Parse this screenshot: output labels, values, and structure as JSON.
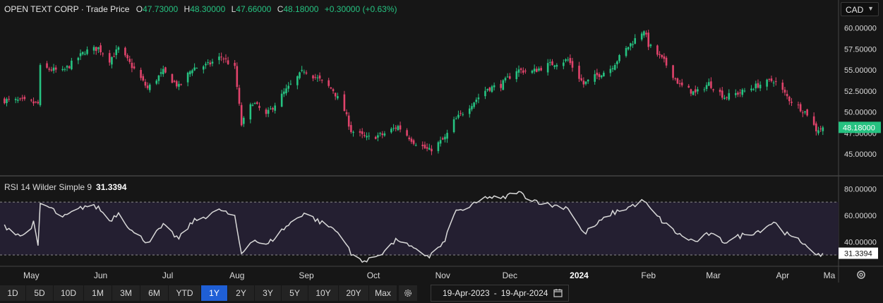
{
  "header": {
    "title": "OPEN TEXT CORP",
    "subtitle": "Trade Price",
    "ohlc": [
      {
        "label": "O",
        "value": "47.73000"
      },
      {
        "label": "H",
        "value": "48.30000"
      },
      {
        "label": "L",
        "value": "47.66000"
      },
      {
        "label": "C",
        "value": "48.18000"
      }
    ],
    "change": "+0.30000 (+0.63%)"
  },
  "currency": "CAD",
  "rsi_legend": {
    "label": "RSI 14 Wilder Simple 9",
    "value": "31.3394"
  },
  "toolbar": {
    "ranges": [
      "1D",
      "5D",
      "10D",
      "1M",
      "3M",
      "6M",
      "YTD",
      "1Y",
      "2Y",
      "3Y",
      "5Y",
      "10Y",
      "20Y",
      "Max"
    ],
    "active": "1Y",
    "date_from": "19-Apr-2023",
    "date_sep": "-",
    "date_to": "19-Apr-2024"
  },
  "colors": {
    "up": "#26c281",
    "down": "#e0436b",
    "rsi": "#d8d8d8",
    "band": "#241f31",
    "active_button": "#1f5fd6"
  },
  "chart_data": [
    {
      "type": "candlestick",
      "title": "OPEN TEXT CORP · Trade Price",
      "ylim": [
        42.5,
        60.8
      ],
      "yticks": [
        "60.00000",
        "57.50000",
        "55.00000",
        "52.50000",
        "50.00000",
        "47.50000",
        "45.00000"
      ],
      "last_price_label": "48.18000",
      "x_ticks": [
        "May",
        "Jun",
        "Jul",
        "Aug",
        "Sep",
        "Oct",
        "Nov",
        "Dec",
        "2024",
        "Feb",
        "Mar",
        "Apr",
        "Ma"
      ],
      "close_anchors": [
        [
          "2023-04-19",
          51.4
        ],
        [
          "2023-04-27",
          51.3
        ],
        [
          "2023-05-04",
          51.0
        ],
        [
          "2023-05-05",
          55.3
        ],
        [
          "2023-05-15",
          54.8
        ],
        [
          "2023-05-25",
          57.2
        ],
        [
          "2023-05-31",
          57.6
        ],
        [
          "2023-06-05",
          56.2
        ],
        [
          "2023-06-09",
          57.5
        ],
        [
          "2023-06-16",
          55.1
        ],
        [
          "2023-06-22",
          52.8
        ],
        [
          "2023-06-29",
          54.8
        ],
        [
          "2023-07-06",
          53.0
        ],
        [
          "2023-07-12",
          55.2
        ],
        [
          "2023-07-19",
          55.6
        ],
        [
          "2023-07-25",
          56.6
        ],
        [
          "2023-07-31",
          55.2
        ],
        [
          "2023-08-03",
          48.5
        ],
        [
          "2023-08-08",
          51.2
        ],
        [
          "2023-08-14",
          49.6
        ],
        [
          "2023-08-22",
          52.3
        ],
        [
          "2023-08-31",
          55.0
        ],
        [
          "2023-09-07",
          53.8
        ],
        [
          "2023-09-13",
          52.6
        ],
        [
          "2023-09-18",
          50.2
        ],
        [
          "2023-09-21",
          47.8
        ],
        [
          "2023-09-28",
          46.9
        ],
        [
          "2023-10-05",
          47.3
        ],
        [
          "2023-10-12",
          48.3
        ],
        [
          "2023-10-19",
          46.5
        ],
        [
          "2023-10-26",
          45.4
        ],
        [
          "2023-11-02",
          46.9
        ],
        [
          "2023-11-06",
          48.9
        ],
        [
          "2023-11-14",
          51.0
        ],
        [
          "2023-11-21",
          52.8
        ],
        [
          "2023-11-27",
          53.2
        ],
        [
          "2023-12-04",
          55.0
        ],
        [
          "2023-12-11",
          54.8
        ],
        [
          "2023-12-18",
          55.6
        ],
        [
          "2023-12-27",
          56.2
        ],
        [
          "2024-01-03",
          53.3
        ],
        [
          "2024-01-08",
          54.2
        ],
        [
          "2024-01-15",
          55.2
        ],
        [
          "2024-01-23",
          57.8
        ],
        [
          "2024-01-30",
          59.8
        ],
        [
          "2024-02-01",
          58.0
        ],
        [
          "2024-02-08",
          56.0
        ],
        [
          "2024-02-15",
          53.2
        ],
        [
          "2024-02-22",
          52.2
        ],
        [
          "2024-02-28",
          53.4
        ],
        [
          "2024-03-06",
          51.8
        ],
        [
          "2024-03-14",
          52.4
        ],
        [
          "2024-03-21",
          53.2
        ],
        [
          "2024-03-28",
          53.8
        ],
        [
          "2024-04-04",
          51.5
        ],
        [
          "2024-04-12",
          49.8
        ],
        [
          "2024-04-16",
          47.9
        ],
        [
          "2024-04-19",
          48.18
        ]
      ]
    },
    {
      "type": "line",
      "title": "RSI 14 Wilder Simple 9",
      "ylim": [
        22,
        85
      ],
      "yticks": [
        "80.00000",
        "60.00000",
        "40.00000"
      ],
      "bands": [
        30,
        70
      ],
      "last_value_label": "31.3394",
      "anchors": [
        [
          "2023-04-19",
          52
        ],
        [
          "2023-04-27",
          44
        ],
        [
          "2023-05-02",
          54
        ],
        [
          "2023-05-04",
          36
        ],
        [
          "2023-05-05",
          69
        ],
        [
          "2023-05-10",
          65
        ],
        [
          "2023-05-15",
          58
        ],
        [
          "2023-05-25",
          67
        ],
        [
          "2023-05-31",
          66
        ],
        [
          "2023-06-05",
          56
        ],
        [
          "2023-06-09",
          62
        ],
        [
          "2023-06-16",
          46
        ],
        [
          "2023-06-22",
          40
        ],
        [
          "2023-06-29",
          52
        ],
        [
          "2023-07-06",
          42
        ],
        [
          "2023-07-12",
          55
        ],
        [
          "2023-07-19",
          60
        ],
        [
          "2023-07-25",
          64
        ],
        [
          "2023-07-31",
          58
        ],
        [
          "2023-08-03",
          31
        ],
        [
          "2023-08-08",
          42
        ],
        [
          "2023-08-14",
          37
        ],
        [
          "2023-08-22",
          50
        ],
        [
          "2023-08-31",
          62
        ],
        [
          "2023-09-07",
          55
        ],
        [
          "2023-09-13",
          50
        ],
        [
          "2023-09-18",
          42
        ],
        [
          "2023-09-21",
          30
        ],
        [
          "2023-09-28",
          25
        ],
        [
          "2023-10-05",
          32
        ],
        [
          "2023-10-12",
          42
        ],
        [
          "2023-10-19",
          34
        ],
        [
          "2023-10-26",
          29
        ],
        [
          "2023-11-02",
          40
        ],
        [
          "2023-11-06",
          62
        ],
        [
          "2023-11-14",
          67
        ],
        [
          "2023-11-21",
          74
        ],
        [
          "2023-11-27",
          72
        ],
        [
          "2023-12-04",
          78
        ],
        [
          "2023-12-11",
          72
        ],
        [
          "2023-12-18",
          68
        ],
        [
          "2023-12-27",
          66
        ],
        [
          "2024-01-03",
          46
        ],
        [
          "2024-01-08",
          52
        ],
        [
          "2024-01-15",
          61
        ],
        [
          "2024-01-23",
          66
        ],
        [
          "2024-01-30",
          71
        ],
        [
          "2024-02-01",
          66
        ],
        [
          "2024-02-08",
          54
        ],
        [
          "2024-02-15",
          45
        ],
        [
          "2024-02-22",
          40
        ],
        [
          "2024-02-28",
          46
        ],
        [
          "2024-03-06",
          40
        ],
        [
          "2024-03-14",
          45
        ],
        [
          "2024-03-21",
          48
        ],
        [
          "2024-03-28",
          55
        ],
        [
          "2024-04-04",
          44
        ],
        [
          "2024-04-12",
          38
        ],
        [
          "2024-04-16",
          28
        ],
        [
          "2024-04-19",
          31.3394
        ]
      ]
    }
  ]
}
